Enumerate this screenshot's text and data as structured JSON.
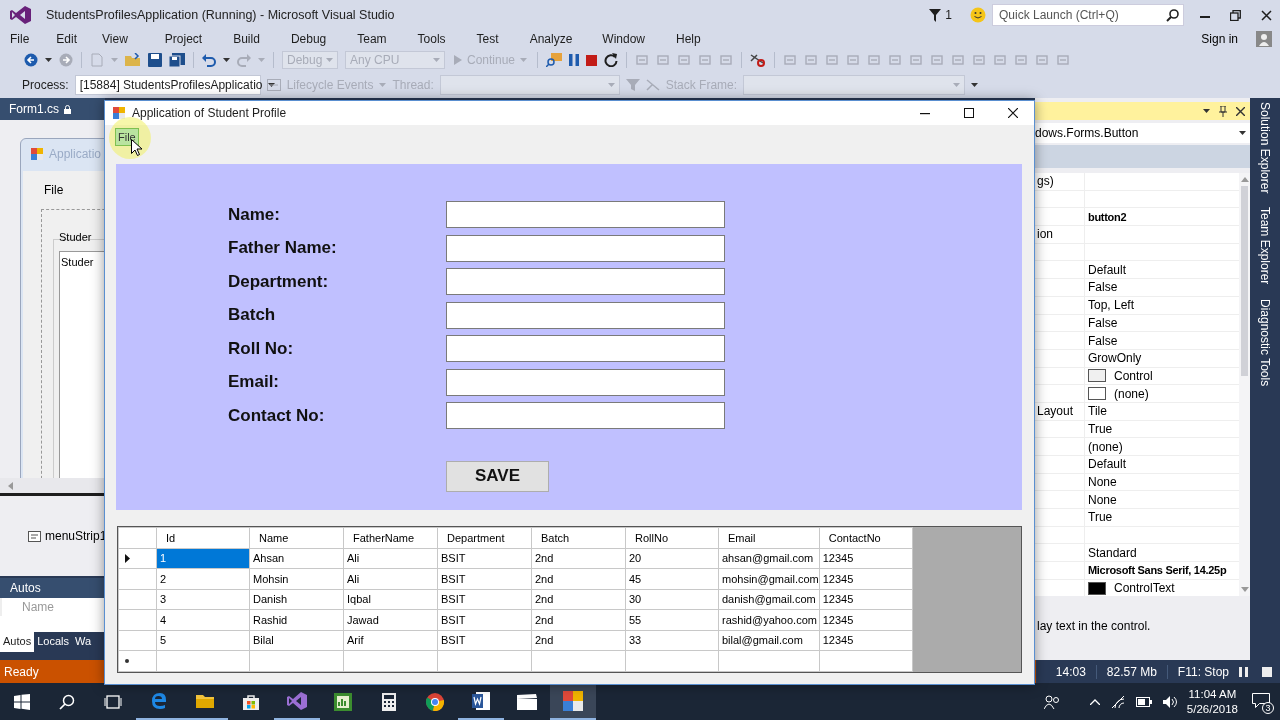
{
  "ide": {
    "title": "StudentsProfilesApplication (Running) - Microsoft Visual Studio",
    "notification_count": "1",
    "quick_launch": {
      "placeholder": "Quick Launch (Ctrl+Q)"
    },
    "menu": [
      "File",
      "Edit",
      "View",
      "Project",
      "Build",
      "Debug",
      "Team",
      "Tools",
      "Test",
      "Analyze",
      "Window",
      "Help"
    ],
    "sign_in": "Sign in"
  },
  "toolbar": {
    "configuration": {
      "value": "Debug",
      "disabled": true
    },
    "platform": {
      "value": "Any CPU",
      "disabled": true
    },
    "continue": {
      "label": "Continue",
      "disabled": true
    }
  },
  "debug_location": {
    "process_label": "Process:",
    "process": "[15884] StudentsProfilesApplicatio",
    "lifecycle": {
      "label": "Lifecycle Events",
      "disabled": true
    },
    "thread_label": "Thread:",
    "stack_frame_label": "Stack Frame:"
  },
  "designer": {
    "tab": "Form1.cs",
    "form_title": "Applicatio",
    "form_menu": "File",
    "group_label": "Studer",
    "list_item": "Studer",
    "tray_item": "menuStrip1"
  },
  "autos": {
    "title": "Autos",
    "column": "Name",
    "tabs": [
      {
        "label": "Autos",
        "selected": true
      },
      {
        "label": "Locals",
        "selected": false
      },
      {
        "label": "Wa",
        "selected": false
      }
    ]
  },
  "properties": {
    "object": "dows.Forms.Button",
    "rows": [
      {
        "kind": "text",
        "name": "gs)"
      },
      {
        "kind": "blank"
      },
      {
        "kind": "text",
        "value": "button2",
        "bold": true
      },
      {
        "kind": "text",
        "name": "ion"
      },
      {
        "kind": "blank"
      },
      {
        "kind": "text",
        "value": "Default",
        "bold": false
      },
      {
        "kind": "text",
        "value": "False",
        "bold": false
      },
      {
        "kind": "text",
        "value": "Top, Left",
        "bold": false
      },
      {
        "kind": "text",
        "value": "False",
        "bold": false
      },
      {
        "kind": "text",
        "value": "False",
        "bold": false
      },
      {
        "kind": "text",
        "value": "GrowOnly",
        "bold": false
      },
      {
        "kind": "color",
        "value": "Control",
        "color": "#f0f0f0"
      },
      {
        "kind": "color",
        "value": "(none)",
        "color": "#ffffff"
      },
      {
        "kind": "text",
        "name": "Layout",
        "value": "Tile",
        "bold": false
      },
      {
        "kind": "text",
        "value": "True",
        "bold": false
      },
      {
        "kind": "text",
        "value": "(none)",
        "bold": false
      },
      {
        "kind": "text",
        "value": "Default",
        "bold": false
      },
      {
        "kind": "text",
        "value": "None",
        "bold": false
      },
      {
        "kind": "text",
        "value": "None",
        "bold": false
      },
      {
        "kind": "text",
        "value": "True",
        "bold": false
      },
      {
        "kind": "blank"
      },
      {
        "kind": "text",
        "value": "Standard",
        "bold": false
      },
      {
        "kind": "text",
        "value": "Microsoft Sans Serif, 14.25p",
        "bold": true
      },
      {
        "kind": "color",
        "value": "ControlText",
        "color": "#000000"
      }
    ],
    "description": "lay text in the control."
  },
  "side_tabs": [
    "Solution Explorer",
    "Team Explorer",
    "Diagnostic Tools"
  ],
  "status_bar": {
    "text": "Ready",
    "time": "14:03",
    "memory": "82.57 Mb",
    "hint": "F11: Stop"
  },
  "app": {
    "title": "Application of Student Profile",
    "menu": [
      {
        "label": "File",
        "hovered": true
      }
    ],
    "fields": [
      {
        "label": "Name:"
      },
      {
        "label": "Father Name:"
      },
      {
        "label": "Department:"
      },
      {
        "label": "Batch"
      },
      {
        "label": "Roll No:"
      },
      {
        "label": "Email:"
      },
      {
        "label": "Contact No:"
      }
    ],
    "save": "SAVE",
    "grid": {
      "columns": [
        "Id",
        "Name",
        "FatherName",
        "Department",
        "Batch",
        "RollNo",
        "Email",
        "ContactNo"
      ],
      "rows": [
        {
          "current": true,
          "selected": true,
          "cells": [
            "1",
            "Ahsan",
            "Ali",
            "BSIT",
            "2nd",
            "20",
            "ahsan@gmail.com",
            "12345"
          ]
        },
        {
          "current": false,
          "selected": false,
          "cells": [
            "2",
            "Mohsin",
            "Ali",
            "BSIT",
            "2nd",
            "45",
            "mohsin@gmail.com",
            "12345"
          ]
        },
        {
          "current": false,
          "selected": false,
          "cells": [
            "3",
            "Danish",
            "Iqbal",
            "BSIT",
            "2nd",
            "30",
            "danish@gmail.com",
            "12345"
          ]
        },
        {
          "current": false,
          "selected": false,
          "cells": [
            "4",
            "Rashid",
            "Jawad",
            "BSIT",
            "2nd",
            "55",
            "rashid@yahoo.com",
            "12345"
          ]
        },
        {
          "current": false,
          "selected": false,
          "cells": [
            "5",
            "Bilal",
            "Arif",
            "BSIT",
            "2nd",
            "33",
            "bilal@gmail.com",
            "12345"
          ]
        }
      ],
      "new_row": true
    }
  },
  "taskbar": {
    "time": "11:04 AM",
    "date": "5/26/2018",
    "notifications": "3"
  }
}
